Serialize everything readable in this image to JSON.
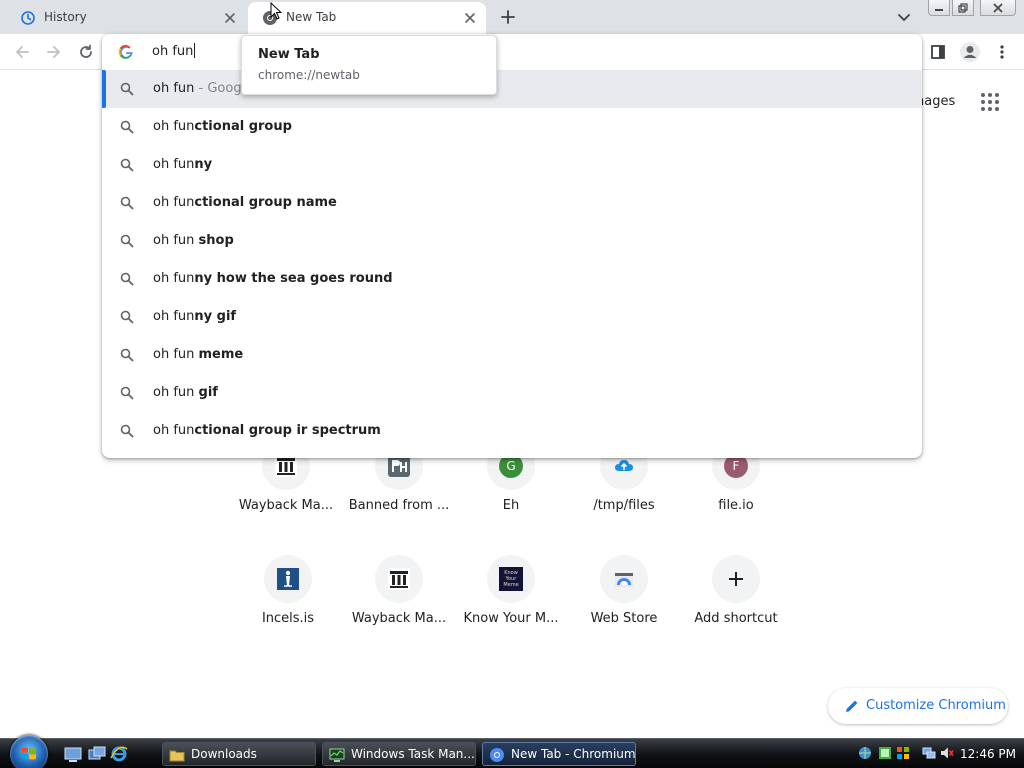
{
  "tabs": [
    {
      "title": "History",
      "active": false,
      "icon": "history-icon"
    },
    {
      "title": "New Tab",
      "active": true,
      "icon": "chromium-icon"
    }
  ],
  "hovercard": {
    "title": "New Tab",
    "url": "chrome://newtab"
  },
  "omnibox": {
    "input_value": "oh fun",
    "suggestions": [
      {
        "typed": "oh fun",
        "bold": "",
        "suffix": " - Goog",
        "selected": true
      },
      {
        "typed": "oh fun",
        "bold": "ctional group"
      },
      {
        "typed": "oh fun",
        "bold": "ny"
      },
      {
        "typed": "oh fun",
        "bold": "ctional group name"
      },
      {
        "typed": "oh fun ",
        "bold": "shop"
      },
      {
        "typed": "oh fun",
        "bold": "ny how the sea goes round"
      },
      {
        "typed": "oh fun",
        "bold": "ny gif"
      },
      {
        "typed": "oh fun ",
        "bold": "meme"
      },
      {
        "typed": "oh fun ",
        "bold": "gif"
      },
      {
        "typed": "oh fun",
        "bold": "ctional group ir spectrum"
      }
    ]
  },
  "ntp": {
    "images_link": "nages",
    "shortcuts_row1": [
      {
        "label": "Wayback Ma...",
        "icon": "wayback-machine-icon"
      },
      {
        "label": "Banned from ...",
        "icon": "ph-icon"
      },
      {
        "label": "Eh",
        "icon": "letter-g-icon",
        "letter": "G"
      },
      {
        "label": "/tmp/files",
        "icon": "cloud-upload-icon"
      },
      {
        "label": "file.io",
        "icon": "letter-f-icon",
        "letter": "F"
      }
    ],
    "shortcuts_row2": [
      {
        "label": "Incels.is",
        "icon": "incels-icon"
      },
      {
        "label": "Wayback Ma...",
        "icon": "wayback-machine-icon"
      },
      {
        "label": "Know Your M...",
        "icon": "know-your-meme-icon",
        "icon_text": "Know Your Meme"
      },
      {
        "label": "Web Store",
        "icon": "web-store-icon"
      },
      {
        "label": "Add shortcut",
        "icon": "plus-icon"
      }
    ],
    "customize_label": "Customize Chromium"
  },
  "taskbar": {
    "tasks": [
      {
        "label": "Downloads",
        "icon": "folder-icon",
        "active": false
      },
      {
        "label": "Windows Task Man...",
        "icon": "task-manager-icon",
        "active": false
      },
      {
        "label": "New Tab - Chromium",
        "icon": "chromium-icon",
        "active": true
      }
    ],
    "clock": "12:46 PM"
  },
  "colors": {
    "accent": "#1a73e8",
    "tabstrip": "#dee1e6",
    "selected_row": "#e8eaed"
  }
}
